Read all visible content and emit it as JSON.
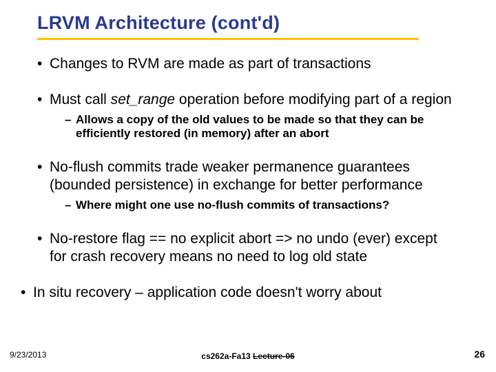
{
  "title": "LRVM Architecture (cont'd)",
  "bullets": [
    {
      "text_before": "Changes to RVM are made as part of transactions",
      "em": "",
      "text_after": "",
      "subs": []
    },
    {
      "text_before": "Must call ",
      "em": "set_range",
      "text_after": " operation before modifying part of a region",
      "subs": [
        "Allows a copy of the old values to be made so that they can be efficiently restored (in memory) after an abort"
      ]
    },
    {
      "text_before": "No-flush commits trade weaker permanence guarantees (bounded persistence) in exchange for better performance",
      "em": "",
      "text_after": "",
      "subs": [
        "Where might one use no-flush commits of transactions?"
      ]
    },
    {
      "text_before": "No-restore flag == no explicit abort => no undo (ever) except for crash recovery means no need to log old state",
      "em": "",
      "text_after": "",
      "subs": []
    },
    {
      "text_before": "In situ recovery – application code doesn't worry about",
      "em": "",
      "text_after": "",
      "subs": []
    }
  ],
  "footer": {
    "date": "9/23/2013",
    "center_a": "cs262a-Fa13 ",
    "center_b": "Lecture-06",
    "page": "26"
  }
}
